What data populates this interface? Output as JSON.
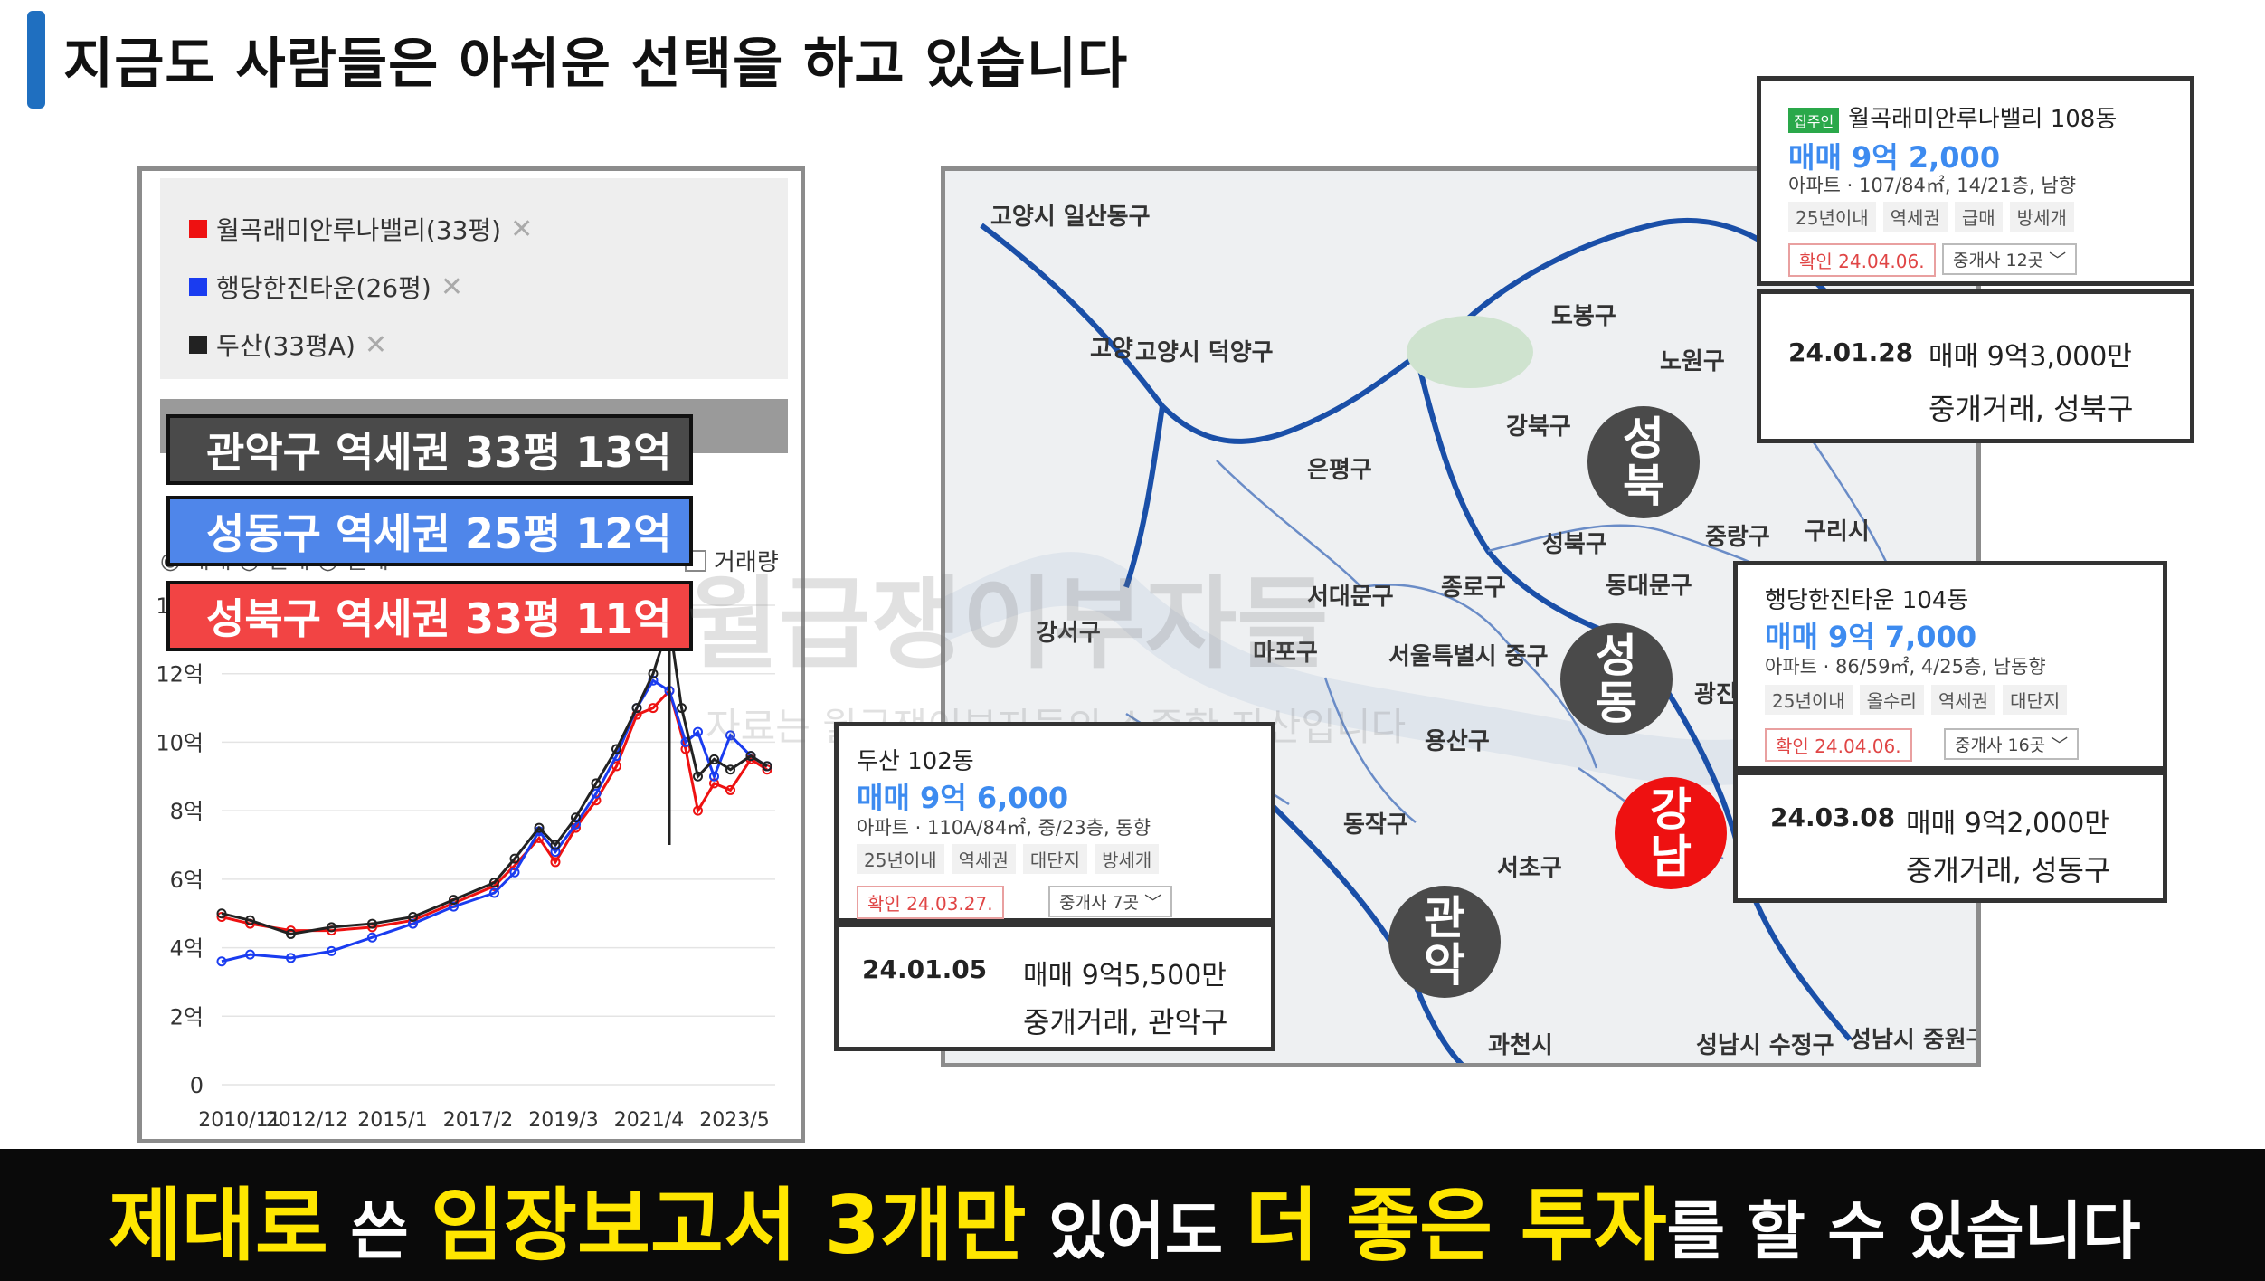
{
  "header": {
    "title": "지금도 사람들은 아쉬운 선택을 하고 있습니다"
  },
  "legend": [
    {
      "label": "월곡래미안루나밸리(33평)",
      "color": "#ee1111"
    },
    {
      "label": "행당한진타운(26평)",
      "color": "#1a3cf0"
    },
    {
      "label": "두산(33평A)",
      "color": "#222222"
    }
  ],
  "legend_remove": "✕",
  "mode_row": "◉ 매매   ○ 전세   ○ 월세",
  "volume_label": "거래량",
  "tags": {
    "gray": "관악구 역세권 33평 13억",
    "blue": "성동구 역세권 25평 12억",
    "red": "성북구 역세권 33평 11억"
  },
  "chart_data": {
    "type": "line",
    "y_tick_labels": [
      "0",
      "2억",
      "4억",
      "6억",
      "8억",
      "10억",
      "12억",
      "14억"
    ],
    "x_tick_labels": [
      "2010/11",
      "2012/12",
      "2015/1",
      "2017/2",
      "2019/3",
      "2021/4",
      "2023/5"
    ],
    "ylim": [
      0,
      14
    ],
    "series": [
      {
        "name": "월곡래미안루나밸리(33평)",
        "color": "#ee1111",
        "x": [
          2010.8,
          2011.5,
          2012.5,
          2013.5,
          2014.5,
          2015.5,
          2016.5,
          2017.5,
          2018.0,
          2018.6,
          2019.0,
          2019.5,
          2020.0,
          2020.5,
          2021.0,
          2021.4,
          2021.8,
          2022.2,
          2022.5,
          2022.9,
          2023.3,
          2023.8,
          2024.2
        ],
        "values": [
          4.9,
          4.7,
          4.5,
          4.5,
          4.6,
          4.8,
          5.3,
          5.8,
          6.4,
          7.2,
          6.5,
          7.5,
          8.3,
          9.3,
          10.8,
          11.0,
          11.5,
          9.8,
          8.0,
          8.8,
          8.6,
          9.5,
          9.2
        ]
      },
      {
        "name": "행당한진타운(26평)",
        "color": "#1a3cf0",
        "x": [
          2010.8,
          2011.5,
          2012.5,
          2013.5,
          2014.5,
          2015.5,
          2016.5,
          2017.5,
          2018.0,
          2018.6,
          2019.0,
          2019.5,
          2020.0,
          2020.5,
          2021.0,
          2021.4,
          2021.8,
          2022.2,
          2022.5,
          2022.9,
          2023.3,
          2023.8,
          2024.2
        ],
        "values": [
          3.6,
          3.8,
          3.7,
          3.9,
          4.3,
          4.7,
          5.2,
          5.6,
          6.2,
          7.4,
          6.8,
          7.6,
          8.5,
          9.6,
          11.0,
          11.8,
          11.5,
          10.0,
          10.3,
          9.0,
          10.2,
          9.6,
          9.3
        ]
      },
      {
        "name": "두산(33평A)",
        "color": "#222222",
        "x": [
          2010.8,
          2011.5,
          2012.5,
          2013.5,
          2014.5,
          2015.5,
          2016.5,
          2017.5,
          2018.0,
          2018.6,
          2019.0,
          2019.5,
          2020.0,
          2020.5,
          2021.0,
          2021.4,
          2021.8,
          2022.1,
          2022.5,
          2022.9,
          2023.3,
          2023.8,
          2024.2
        ],
        "values": [
          5.0,
          4.8,
          4.4,
          4.6,
          4.7,
          4.9,
          5.4,
          5.9,
          6.6,
          7.5,
          7.0,
          7.8,
          8.8,
          9.8,
          11.0,
          12.0,
          13.5,
          11.0,
          9.0,
          9.5,
          9.2,
          9.6,
          9.3
        ]
      }
    ]
  },
  "map": {
    "labels": [
      "고양시 일산동구",
      "고양시 덕양구",
      "도봉구",
      "노원구",
      "강북구",
      "은평구",
      "성북구",
      "중랑구",
      "구리시",
      "서대문구",
      "종로구",
      "동대문구",
      "강서구",
      "마포구",
      "서울특별시 중구",
      "광진",
      "용산구",
      "동작구",
      "서초구",
      "관악구",
      "과천시",
      "성남시 수정구",
      "성남시 중원구",
      "고양"
    ],
    "watermark": "월급쟁이부자들",
    "watermark_sub": "자료는 월급쟁이부자들의 소중한 자산입니다",
    "circles": {
      "seongbuk": "성\n북",
      "seongdong": "성\n동",
      "gangnam": "강\n남",
      "gwanak": "관\n악"
    }
  },
  "cards": {
    "wolgok": {
      "badge": "집주인",
      "name": "월곡래미안루나밸리 108동",
      "price": "매매 9억 2,000",
      "spec": "아파트 · 107/84㎡, 14/21층, 남향",
      "chips": [
        "25년이내",
        "역세권",
        "급매",
        "방세개"
      ],
      "confirm": "확인 24.04.06.",
      "agents": "중개사 12곳 ﹀"
    },
    "haengdang": {
      "name": "행당한진타운 104동",
      "price": "매매 9억 7,000",
      "spec": "아파트 · 86/59㎡, 4/25층, 남동향",
      "chips": [
        "25년이내",
        "올수리",
        "역세권",
        "대단지"
      ],
      "confirm": "확인 24.04.06.",
      "agents": "중개사 16곳 ﹀"
    },
    "doosan": {
      "name": "두산 102동",
      "price": "매매 9억 6,000",
      "spec": "아파트 · 110A/84㎡, 중/23층, 동향",
      "chips": [
        "25년이내",
        "역세권",
        "대단지",
        "방세개"
      ],
      "confirm": "확인 24.03.27.",
      "agents": "중개사 7곳 ﹀"
    }
  },
  "trades": {
    "wolgok": {
      "date": "24.01.28",
      "price": "매매 9억3,000만",
      "type": "중개거래, 성북구"
    },
    "haengdang": {
      "date": "24.03.08",
      "price": "매매 9억2,000만",
      "type": "중개거래, 성동구"
    },
    "doosan": {
      "date": "24.01.05",
      "price": "매매 9억5,500만",
      "type": "중개거래, 관악구"
    }
  },
  "banner": {
    "p1": "제대로",
    "p2": " 쓴 ",
    "p3": "임장보고서 3개만",
    "p4": " 있어도 ",
    "p5": "더 좋은 투자",
    "p6": "를 할 수 있습니다"
  }
}
